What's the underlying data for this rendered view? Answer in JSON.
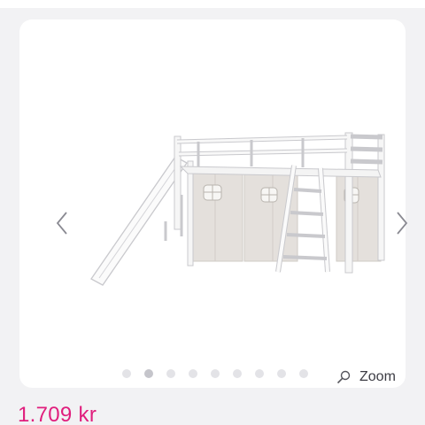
{
  "gallery": {
    "zoom_label": "Zoom",
    "slide_count": 9,
    "active_slide_index": 1,
    "image_subject": "white-wooden-loft-bed-with-slide-ladder-and-beige-curtains"
  },
  "product": {
    "price": "1.709 kr"
  },
  "colors": {
    "price": "#e01e7d",
    "background": "#f2f2f4",
    "card": "#ffffff",
    "dot_inactive": "#e3e3e7",
    "dot_active": "#c5c5cb"
  },
  "icons": {
    "prev": "chevron-left-icon",
    "next": "chevron-right-icon",
    "zoom": "magnifier-icon"
  }
}
